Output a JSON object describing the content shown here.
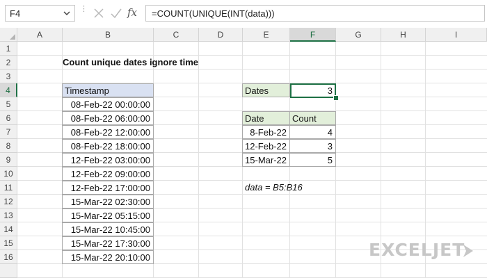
{
  "formula_bar": {
    "name_box": "F4",
    "fx": "fx",
    "formula": "=COUNT(UNIQUE(INT(data)))"
  },
  "columns": [
    "A",
    "B",
    "C",
    "D",
    "E",
    "F",
    "G",
    "H",
    "I"
  ],
  "active_column": "F",
  "rows": [
    "1",
    "2",
    "3",
    "4",
    "5",
    "6",
    "7",
    "8",
    "9",
    "10",
    "11",
    "12",
    "13",
    "14",
    "15",
    "16"
  ],
  "active_row": "4",
  "title": "Count unique dates ignore time",
  "timestamps": {
    "header": "Timestamp",
    "values": [
      "08-Feb-22 00:00:00",
      "08-Feb-22 06:00:00",
      "08-Feb-22 12:00:00",
      "08-Feb-22 18:00:00",
      "12-Feb-22 03:00:00",
      "12-Feb-22 09:00:00",
      "12-Feb-22 17:00:00",
      "15-Mar-22 02:30:00",
      "15-Mar-22 05:15:00",
      "15-Mar-22 10:45:00",
      "15-Mar-22 17:30:00",
      "15-Mar-22 20:10:00"
    ]
  },
  "dates_summary": {
    "label": "Dates",
    "value": "3"
  },
  "count_table": {
    "headers": [
      "Date",
      "Count"
    ],
    "rows": [
      {
        "date": "8-Feb-22",
        "count": "4"
      },
      {
        "date": "12-Feb-22",
        "count": "3"
      },
      {
        "date": "15-Mar-22",
        "count": "5"
      }
    ]
  },
  "note": "data = B5:B16",
  "logo": "EXCELJET",
  "colors": {
    "accent_green": "#1e7145",
    "header_blue": "#d9e1f2",
    "header_green": "#e2efda",
    "logo_gray": "#c7c7c7"
  }
}
